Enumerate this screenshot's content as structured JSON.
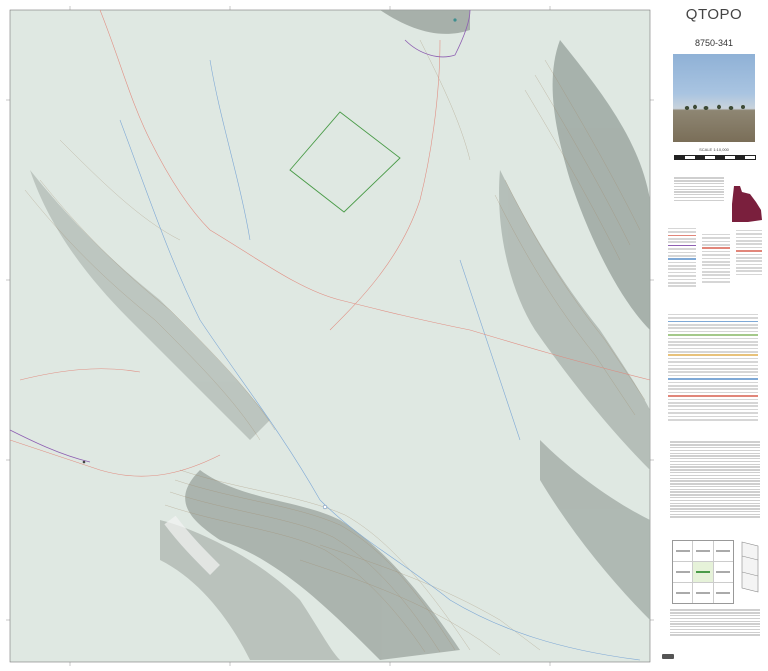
{
  "brand": "QTOPO",
  "sheet_number": "8750-341",
  "scale_text": "SCALE 1:10,000",
  "colors": {
    "map_background": "#dfe8e2",
    "contour": "#a08a6b",
    "road": "#e1867a",
    "watercourse": "#7fa9d6",
    "boundary_purple": "#8e5fb2",
    "parcel_outline": "#4a9b48",
    "queensland_highlight": "#7a1f3d"
  },
  "icons": {
    "cover_photo": "landscape-photo-icon",
    "location_map": "queensland-map-icon",
    "map_index": "map-index-icon",
    "fold_diagram": "fold-diagram-icon",
    "licence": "creative-commons-icon"
  }
}
